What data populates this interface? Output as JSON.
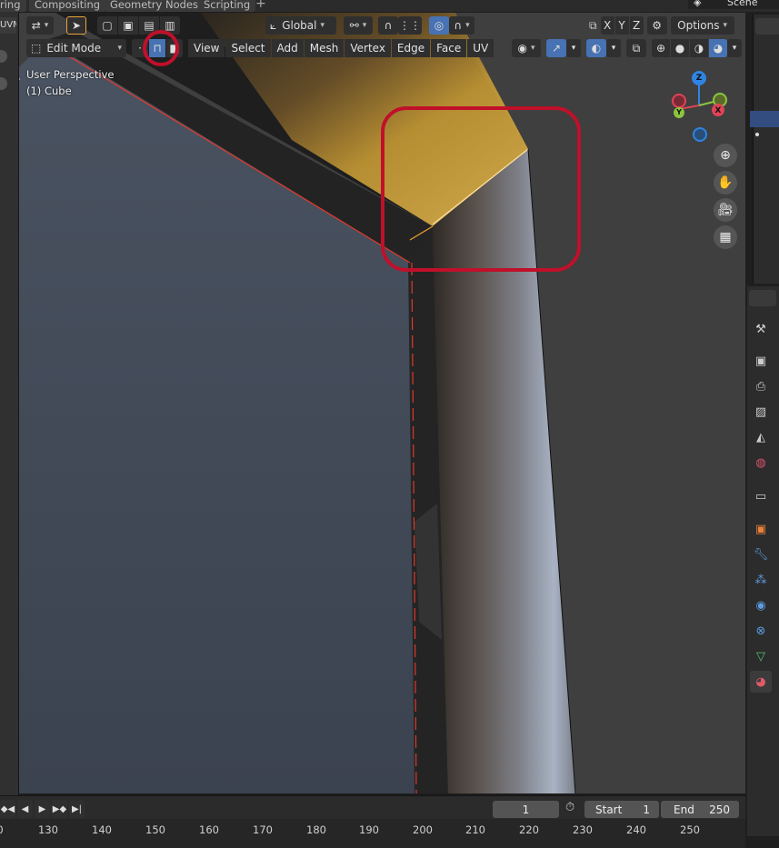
{
  "workspace_tabs": [
    "ring",
    "Compositing",
    "Geometry Nodes",
    "Scripting"
  ],
  "add_tab_label": "+",
  "scene_name": "Scene",
  "header": {
    "orientation": "Global",
    "options_label": "Options",
    "axes": [
      "X",
      "Y",
      "Z"
    ]
  },
  "mode_header": {
    "mode": "Edit Mode",
    "menus": [
      "View",
      "Select",
      "Add",
      "Mesh",
      "Vertex",
      "Edge",
      "Face",
      "UV"
    ]
  },
  "left_partial_label": "UVM",
  "overlay": {
    "perspective": "User Perspective",
    "object": "(1) Cube"
  },
  "gizmo": {
    "x": "X",
    "y": "Y",
    "z": "Z"
  },
  "timeline": {
    "current_frame": "1",
    "start_label": "Start",
    "start_value": "1",
    "end_label": "End",
    "end_value": "250",
    "ticks": [
      "0",
      "130",
      "140",
      "150",
      "160",
      "170",
      "180",
      "190",
      "200",
      "210",
      "220",
      "230",
      "240",
      "250"
    ]
  },
  "colors": {
    "accent": "#4772b3",
    "highlight_circle": "#c0102a",
    "gizmo_x": "#e04357",
    "gizmo_y": "#8bc53f",
    "gizmo_z": "#2f84e3"
  }
}
